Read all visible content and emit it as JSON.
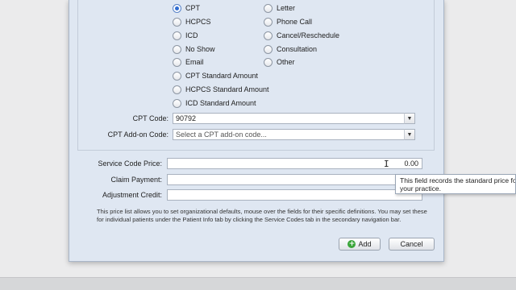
{
  "code_types": {
    "left": [
      {
        "label": "CPT",
        "checked": true
      },
      {
        "label": "HCPCS",
        "checked": false
      },
      {
        "label": "ICD",
        "checked": false
      },
      {
        "label": "No Show",
        "checked": false
      },
      {
        "label": "Email",
        "checked": false
      },
      {
        "label": "CPT Standard Amount",
        "checked": false
      },
      {
        "label": "HCPCS Standard Amount",
        "checked": false
      },
      {
        "label": "ICD Standard Amount",
        "checked": false
      }
    ],
    "right": [
      {
        "label": "Letter",
        "checked": false
      },
      {
        "label": "Phone Call",
        "checked": false
      },
      {
        "label": "Cancel/Reschedule",
        "checked": false
      },
      {
        "label": "Consultation",
        "checked": false
      },
      {
        "label": "Other",
        "checked": false
      }
    ]
  },
  "cpt_code": {
    "label": "CPT Code:",
    "value": "90792"
  },
  "cpt_addon": {
    "label": "CPT Add-on Code:",
    "placeholder": "Select a CPT add-on code..."
  },
  "service_price": {
    "label": "Service Code Price:",
    "value": "0.00"
  },
  "claim_payment": {
    "label": "Claim Payment:",
    "value": ""
  },
  "adjustment_credit": {
    "label": "Adjustment Credit:",
    "value": ""
  },
  "tooltip": {
    "line1": "This field records the standard price for",
    "line2": "your practice."
  },
  "help_text": "This price list allows you to set organizational defaults, mouse over the fields for their specific definitions. You may set these for individual patients under the Patient Info tab by clicking the Service Codes tab in the secondary navigation bar.",
  "buttons": {
    "add": "Add",
    "cancel": "Cancel"
  },
  "icons": {
    "add": "plus-circle-icon",
    "dropdown": "chevron-down-icon"
  },
  "colors": {
    "dialog_bg": "#dfe7f2",
    "add_icon": "#3aa53a",
    "radio_selected": "#2f6cd0"
  }
}
